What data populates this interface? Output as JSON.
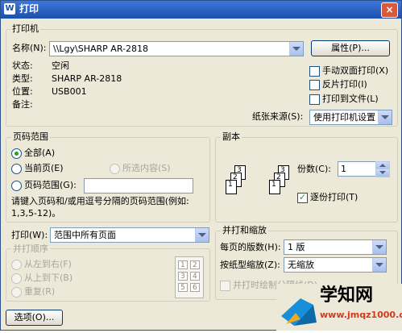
{
  "window": {
    "title": "打印",
    "icon_text": "W",
    "close_glyph": "×"
  },
  "printer": {
    "group_label": "打印机",
    "name_label": "名称(N):",
    "name_value": "\\\\Lgy\\SHARP AR-2818",
    "properties_button": "属性(P)...",
    "status_label": "状态:",
    "status_value": "空闲",
    "type_label": "类型:",
    "type_value": "SHARP AR-2818",
    "location_label": "位置:",
    "location_value": "USB001",
    "comment_label": "备注:",
    "manual_duplex": "手动双面打印(X)",
    "reverse_print": "反片打印(I)",
    "print_to_file": "打印到文件(L)",
    "paper_source_label": "纸张来源(S):",
    "paper_source_value": "使用打印机设置"
  },
  "page_range": {
    "group_label": "页码范围",
    "all": "全部(A)",
    "current_page": "当前页(E)",
    "selection": "所选内容(S)",
    "pages": "页码范围(G):",
    "hint_line1": "请键入页码和/或用逗号分隔的页码范围(例如:",
    "hint_line2": "1,3,5-12)。"
  },
  "print_what": {
    "label": "打印(W):",
    "value": "范围中所有页面"
  },
  "collate_order": {
    "group_label": "并打顺序",
    "left_to_right": "从左到右(F)",
    "top_to_bottom": "从上到下(B)",
    "repeat": "重复(R)",
    "preview_numbers": [
      "1",
      "2",
      "3",
      "4",
      "5",
      "6"
    ]
  },
  "copies": {
    "group_label": "副本",
    "count_label": "份数(C):",
    "count_value": "1",
    "collate": "逐份打印(T)",
    "page_numbers": [
      "3",
      "2",
      "1"
    ]
  },
  "zoom": {
    "group_label": "并打和缩放",
    "pages_per_sheet_label": "每页的版数(H):",
    "pages_per_sheet_value": "1 版",
    "scale_label": "按纸型缩放(Z):",
    "scale_value": "无缩放",
    "draw_borders": "并打时绘制分隔线(D)"
  },
  "buttons": {
    "options": "选项(O)..."
  },
  "watermark": {
    "brand": "学知网",
    "url": "www.jmqz1000.com"
  }
}
